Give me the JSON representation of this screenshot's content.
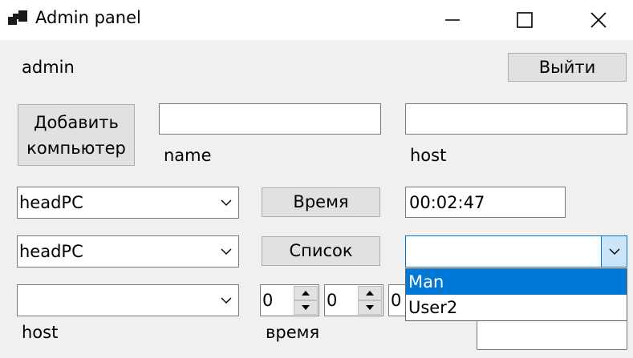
{
  "window": {
    "title": "Admin panel"
  },
  "user": {
    "name": "admin"
  },
  "buttons": {
    "logout": "Выйти",
    "add_computer": "Добавить компьютер",
    "time": "Время",
    "list": "Список"
  },
  "labels": {
    "name": "name",
    "host_top": "host",
    "host_bottom": "host",
    "time_label": "время"
  },
  "inputs": {
    "name_value": "",
    "host_value": "",
    "time_display": "00:02:47",
    "bottom_right_value": ""
  },
  "combos": {
    "pc_time": "headPC",
    "pc_list": "headPC",
    "host_select": "",
    "user_select": ""
  },
  "spinners": {
    "first": "0",
    "second": "0",
    "third": "0"
  },
  "dropdown": {
    "items": [
      "Man",
      "User2"
    ],
    "selected": "Man"
  },
  "colors": {
    "accent": "#0078d7",
    "window_bg": "#f0f0f0",
    "button_bg": "#e1e1e1"
  }
}
